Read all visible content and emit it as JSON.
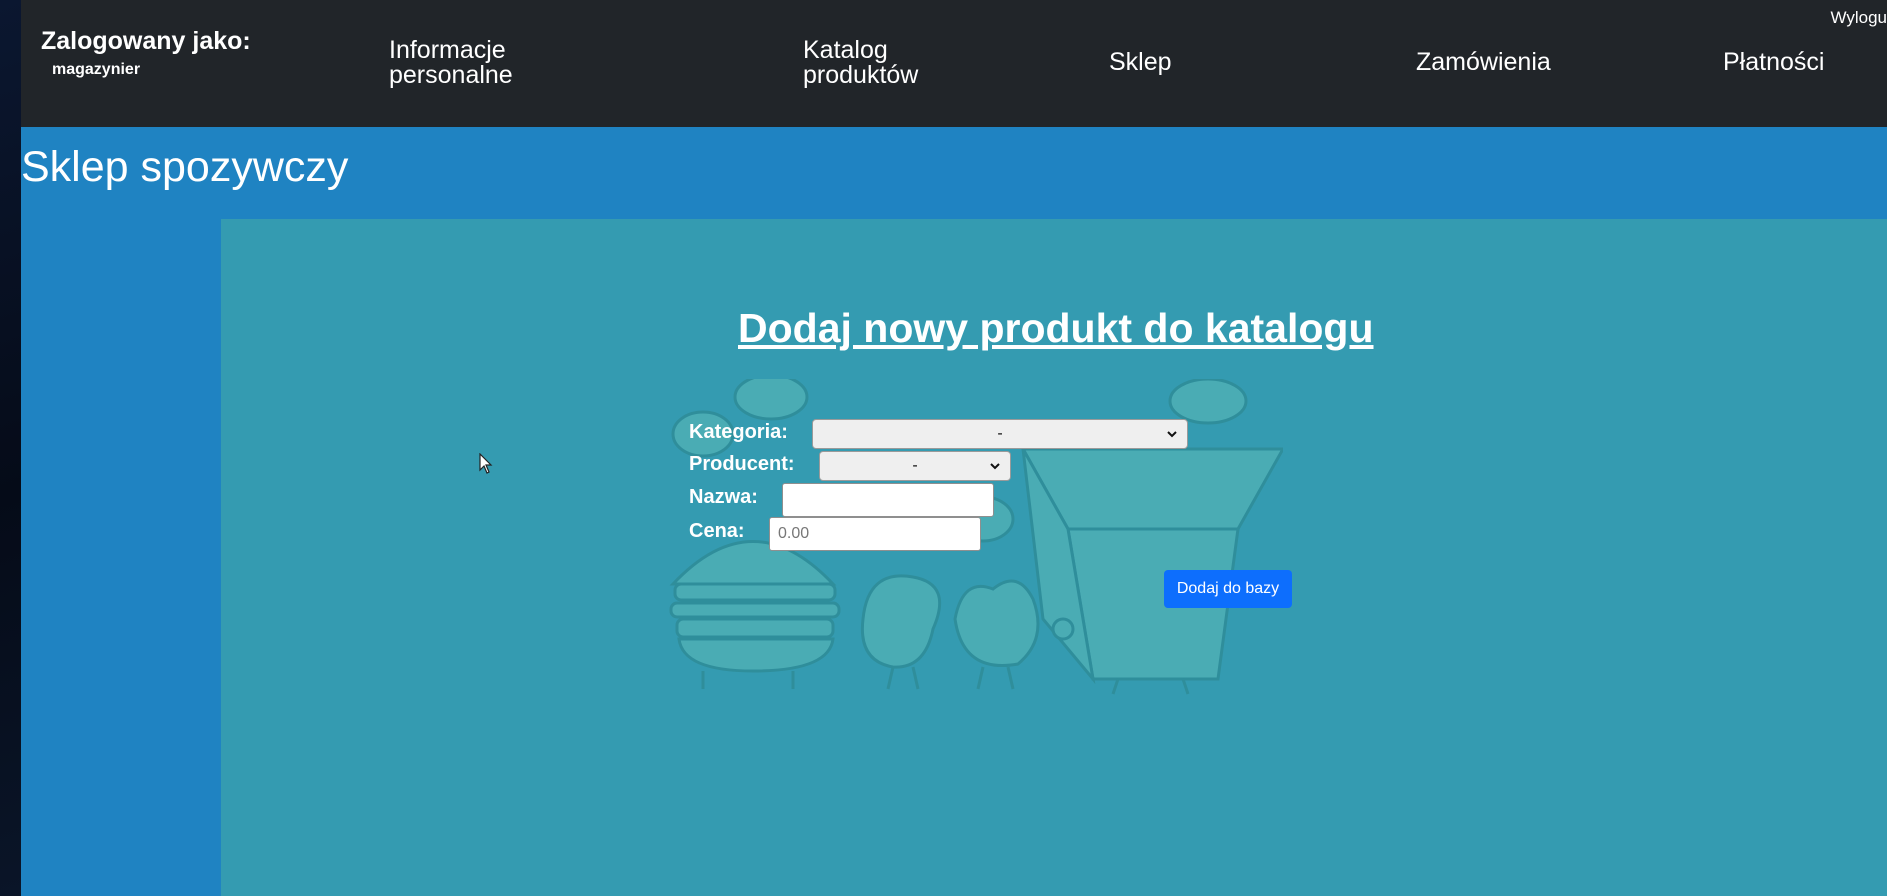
{
  "navbar": {
    "user_title": "Zalogowany jako:",
    "user_name": "magazynier",
    "links": [
      {
        "line1": "Informacje",
        "line2": "personalne"
      },
      {
        "line1": "Katalog",
        "line2": "produktów"
      },
      {
        "line1": "Sklep",
        "line2": ""
      },
      {
        "line1": "Zamówienia",
        "line2": ""
      },
      {
        "line1": "Płatności",
        "line2": ""
      }
    ],
    "logout": "Wylogu"
  },
  "banner": {
    "title": "Sklep spozywczy"
  },
  "form": {
    "heading": "Dodaj nowy produkt do katalogu",
    "category_label": "Kategoria:",
    "category_value": "-",
    "producer_label": "Producent:",
    "producer_value": "-",
    "name_label": "Nazwa:",
    "name_value": "",
    "price_label": "Cena:",
    "price_placeholder": "0.00",
    "submit_label": "Dodaj do bazy"
  },
  "colors": {
    "navbar_bg": "#212529",
    "banner_bg": "#1f83c2",
    "content_bg": "#349bb1",
    "button_bg": "#0d6efd"
  }
}
